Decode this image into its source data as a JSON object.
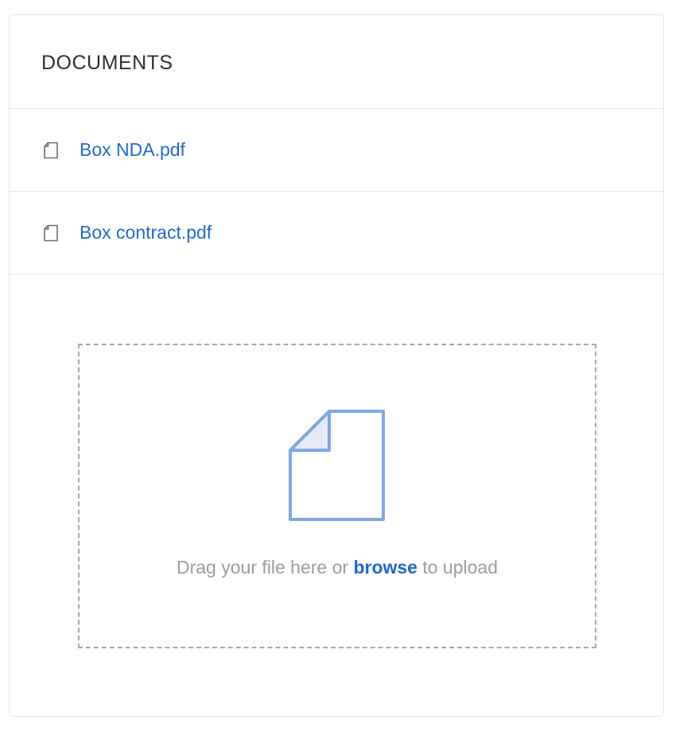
{
  "panel": {
    "title": "DOCUMENTS"
  },
  "documents": [
    {
      "name": "Box NDA.pdf",
      "icon": "file-icon"
    },
    {
      "name": "Box contract.pdf",
      "icon": "file-icon"
    }
  ],
  "upload": {
    "text_before": "Drag your file here or ",
    "browse_label": "browse",
    "text_after": " to upload",
    "icon": "document-upload-icon"
  },
  "colors": {
    "link": "#2267d3",
    "border": "#e3e6ee",
    "dashed_border": "#a9a9ad",
    "upload_icon_stroke": "#7ea7e6",
    "upload_icon_fold_fill": "#e6eaf4",
    "muted_text": "#9b9ca1"
  }
}
